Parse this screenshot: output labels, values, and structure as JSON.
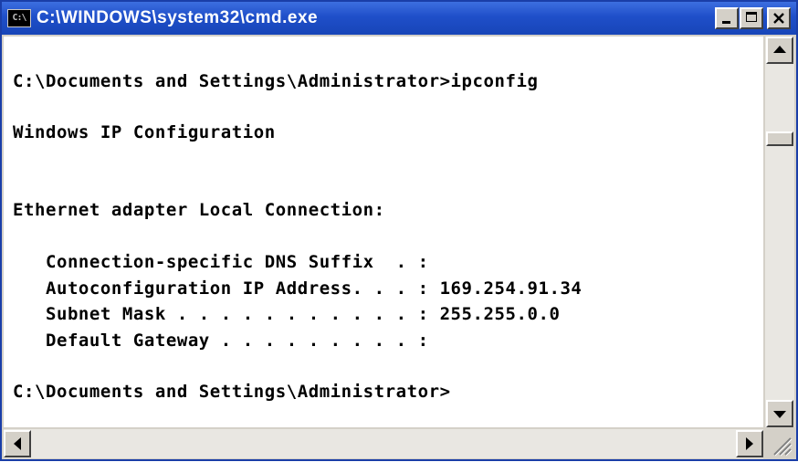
{
  "window": {
    "title": "C:\\WINDOWS\\system32\\cmd.exe",
    "icon_text": "C:\\"
  },
  "console": {
    "lines": [
      "C:\\Documents and Settings\\Administrator>ipconfig",
      "Windows IP Configuration",
      "Ethernet adapter Local Connection:",
      "   Connection-specific DNS Suffix  . :",
      "   Autoconfiguration IP Address. . . : 169.254.91.34",
      "   Subnet Mask . . . . . . . . . . . : 255.255.0.0",
      "   Default Gateway . . . . . . . . . :",
      "C:\\Documents and Settings\\Administrator>"
    ]
  },
  "colors": {
    "titlebar": "#1f4fc9",
    "console_bg": "#ffffff",
    "console_text": "#000000"
  },
  "icons": {
    "minimize": "minimize-icon",
    "maximize": "maximize-icon",
    "close": "close-icon",
    "scroll_up": "arrow-up-icon",
    "scroll_down": "arrow-down-icon",
    "scroll_left": "arrow-left-icon",
    "scroll_right": "arrow-right-icon",
    "resize": "resize-grip-icon"
  }
}
